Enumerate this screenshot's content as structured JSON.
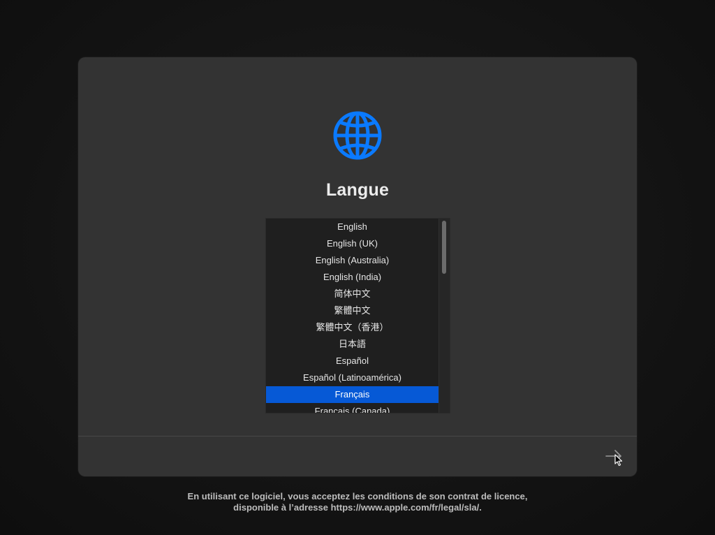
{
  "installer": {
    "title": "Langue",
    "icon": "globe-icon",
    "accent_color": "#0A7AFF",
    "selection_color": "#0659D6",
    "languages": [
      {
        "label": "English",
        "selected": false
      },
      {
        "label": "English (UK)",
        "selected": false
      },
      {
        "label": "English (Australia)",
        "selected": false
      },
      {
        "label": "English (India)",
        "selected": false
      },
      {
        "label": "简体中文",
        "selected": false
      },
      {
        "label": "繁體中文",
        "selected": false
      },
      {
        "label": "繁體中文（香港）",
        "selected": false
      },
      {
        "label": "日本語",
        "selected": false
      },
      {
        "label": "Español",
        "selected": false
      },
      {
        "label": "Español (Latinoamérica)",
        "selected": false
      },
      {
        "label": "Français",
        "selected": true
      },
      {
        "label": "Français (Canada)",
        "selected": false
      }
    ],
    "next_button_icon": "arrow-right-icon"
  },
  "license": {
    "line1": "En utilisant ce logiciel, vous acceptez les conditions de son contrat de licence,",
    "line2": "disponible à l’adresse https://www.apple.com/fr/legal/sla/."
  }
}
